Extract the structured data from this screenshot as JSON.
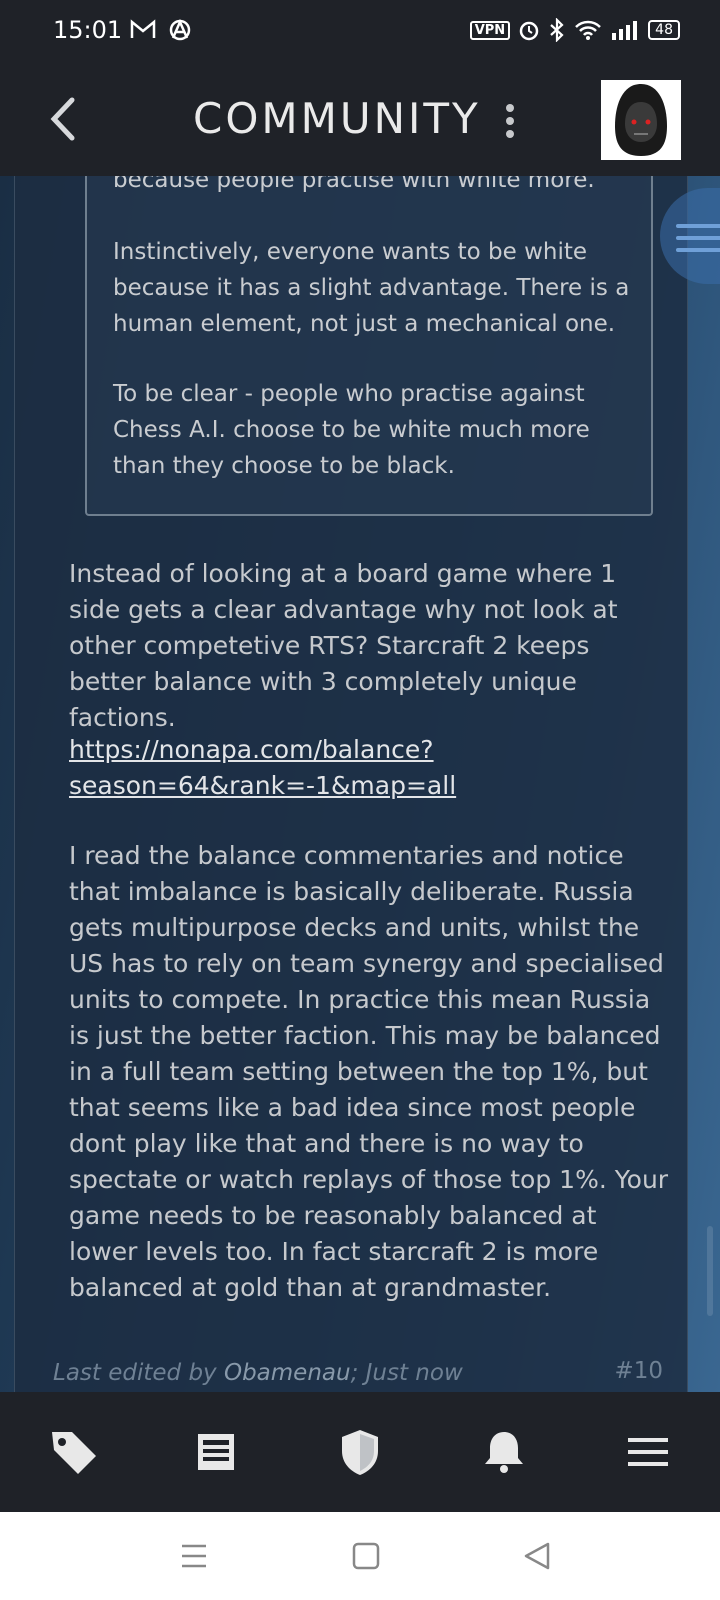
{
  "status_bar": {
    "time": "15:01",
    "left_icons": [
      "gmail-icon",
      "app-icon"
    ],
    "vpn_label": "VPN",
    "battery": "48"
  },
  "header": {
    "title": "COMMUNITY"
  },
  "quote": {
    "lines": [
      "because people practise with white more.",
      "Instinctively, everyone wants to be white because it has a slight advantage. There is a human element, not just a mechanical one.",
      "To be clear - people who practise against Chess A.I. choose to be white much more than they choose to be black."
    ]
  },
  "post": {
    "paragraph1": "Instead of looking at a board game where 1 side gets a clear advantage why not look at other competetive RTS? Starcraft 2 keeps better balance with 3 completely unique factions.",
    "link_line1": "https://nonapa.com/balance?",
    "link_line2": "season=64&rank=-1&map=all",
    "paragraph2": "I read the balance commentaries and notice that imbalance is basically deliberate. Russia gets multipurpose decks and units, whilst the US has to rely on team synergy and specialised units to compete. In practice this mean Russia is just the better faction. This may be balanced in a full team setting between the top 1%, but that seems like a bad idea since most people dont play like that and there is no way to spectate or watch replays of those top 1%. Your game needs to be reasonably balanced at lower levels too. In fact starcraft 2 is more balanced at gold than at grandmaster.",
    "edited_prefix": "Last edited by ",
    "edited_author": "Obamenau",
    "edited_suffix": "; Just now",
    "post_number": "#10"
  },
  "tabbar": {
    "items": [
      "tag-icon",
      "news-icon",
      "shield-icon",
      "bell-icon",
      "menu-icon"
    ]
  }
}
